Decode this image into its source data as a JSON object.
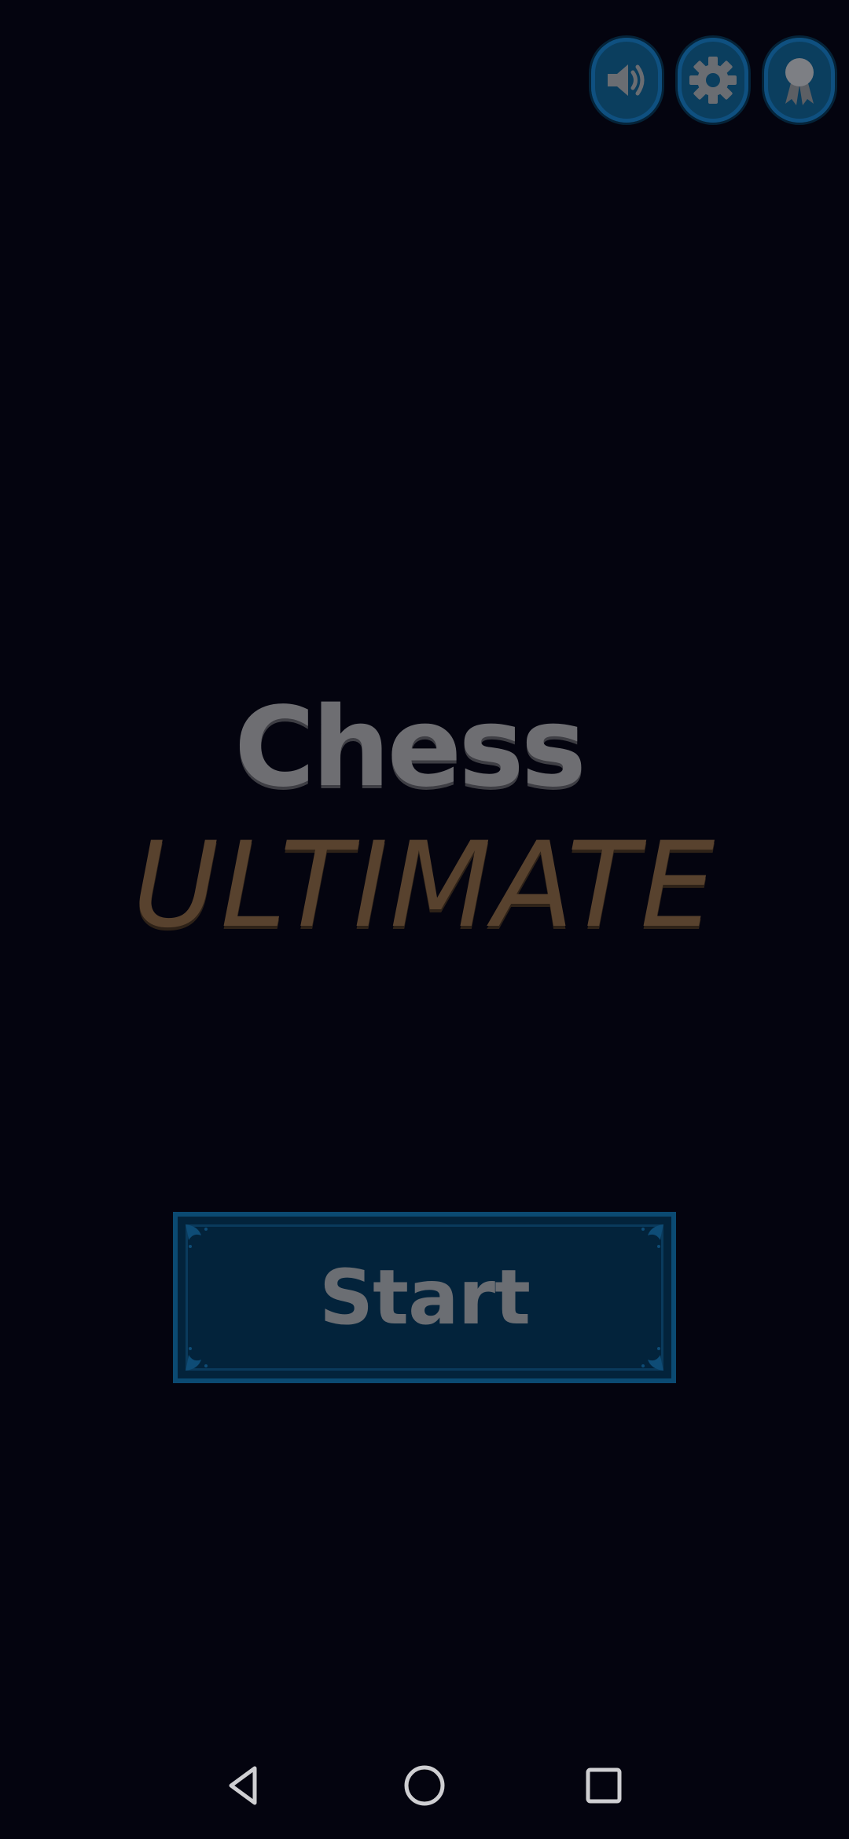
{
  "app": {
    "title_line1": "Chess",
    "title_line2": "ULTIMATE"
  },
  "top_buttons": [
    {
      "icon": "speaker-icon"
    },
    {
      "icon": "gear-icon"
    },
    {
      "icon": "award-ribbon-icon"
    }
  ],
  "start_button": {
    "label": "Start"
  },
  "nav_bar": {
    "back_icon": "back-triangle-icon",
    "home_icon": "home-circle-icon",
    "recents_icon": "recents-square-icon"
  },
  "colors": {
    "background": "#04040f",
    "button_fill": "#0b3e5e",
    "start_fill": "#03233b",
    "title_gray": "#6e6e72",
    "ultimate_brown": "#58422e"
  }
}
